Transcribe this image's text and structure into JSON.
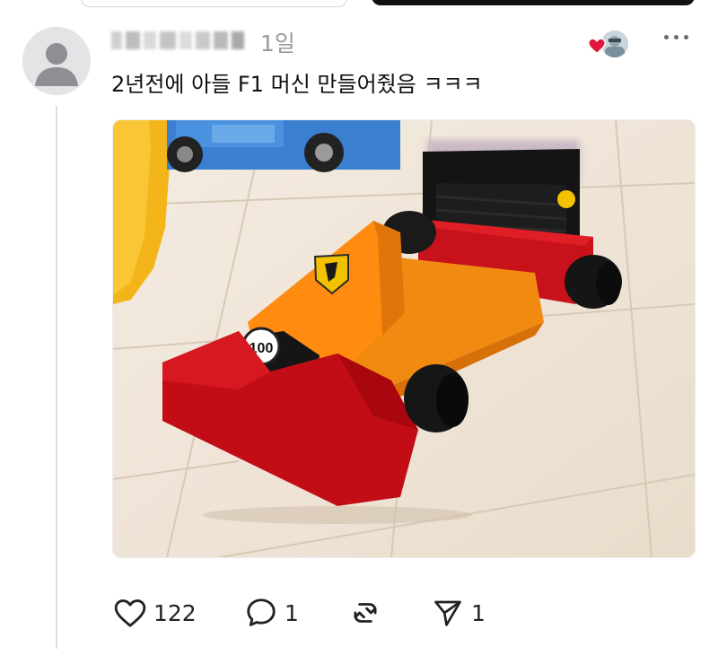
{
  "post": {
    "time_ago": "1일",
    "text": "2년전에 아들 F1 머신 만들어줬음 ㅋㅋㅋ",
    "media": {
      "badge_number": "100"
    }
  },
  "actions": {
    "likes": "122",
    "replies": "1",
    "shares": "1"
  },
  "colors": {
    "heart": "#e0163a",
    "thread_line": "#dedede",
    "time_text": "#9a9a9a"
  }
}
